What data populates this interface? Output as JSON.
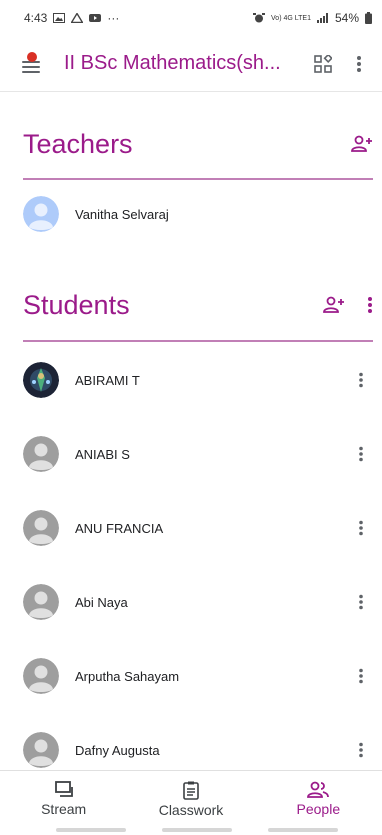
{
  "status_bar": {
    "time": "4:43",
    "more": "···",
    "network": "Vo) 4G LTE1",
    "battery": "54%"
  },
  "app_bar": {
    "title": "II BSc Mathematics(sh..."
  },
  "teachers": {
    "title": "Teachers",
    "items": [
      {
        "name": "Vanitha Selvaraj"
      }
    ]
  },
  "students": {
    "title": "Students",
    "items": [
      {
        "name": "ABIRAMI T"
      },
      {
        "name": "ANIABI S"
      },
      {
        "name": "ANU FRANCIA"
      },
      {
        "name": "Abi Naya"
      },
      {
        "name": "Arputha Sahayam"
      },
      {
        "name": "Dafny Augusta"
      }
    ]
  },
  "bottom_nav": {
    "stream": "Stream",
    "classwork": "Classwork",
    "people": "People"
  },
  "colors": {
    "accent": "#9b1b8a",
    "rule": "#c17fb6",
    "avatar_gray": "#9e9e9e"
  }
}
